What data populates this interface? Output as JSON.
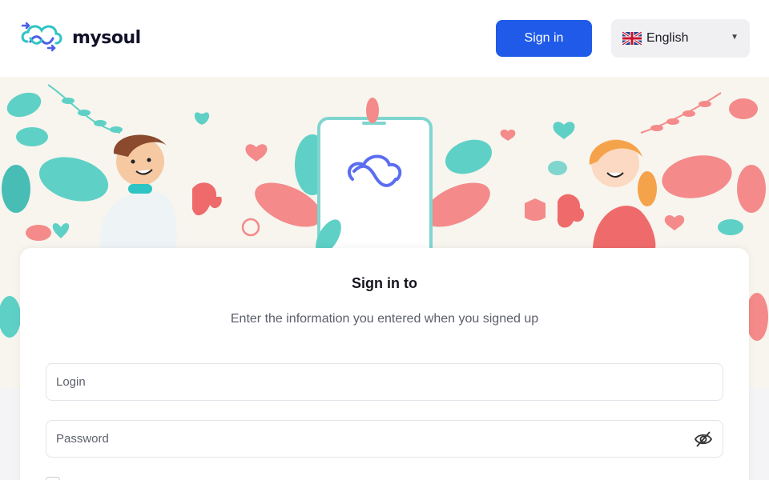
{
  "header": {
    "brand": "mysoul",
    "signin_label": "Sign in",
    "language": {
      "selected": "English",
      "flag": "uk-flag-icon"
    }
  },
  "card": {
    "title": "Sign in to",
    "subtitle": "Enter the information you entered when you signed up",
    "login_label": "Login",
    "password_label": "Password"
  },
  "colors": {
    "primary": "#1f5ae8",
    "logo_teal": "#2ec4c4",
    "logo_blue": "#4a5ee8",
    "leaf_teal": "#5fd0c6",
    "leaf_pink": "#f48a8a"
  }
}
